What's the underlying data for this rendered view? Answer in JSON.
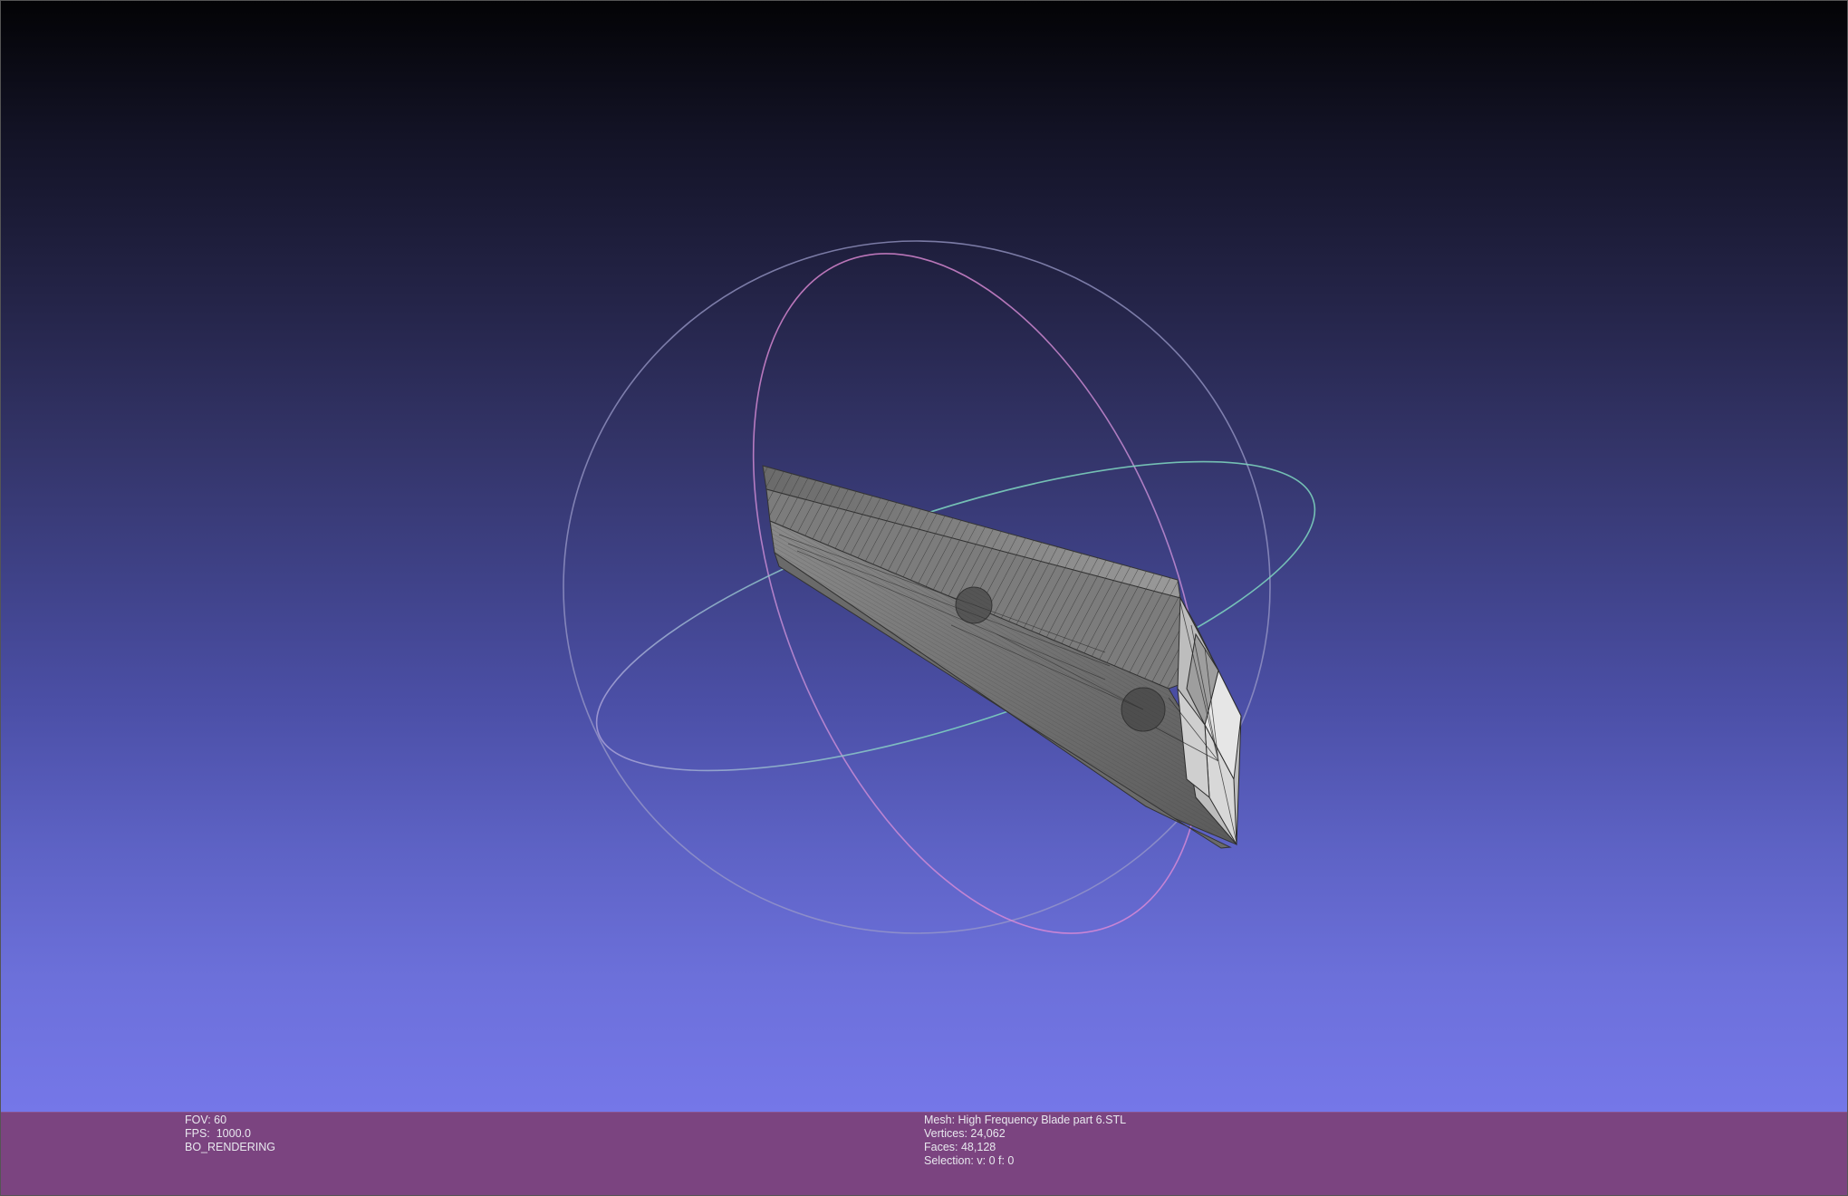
{
  "viewport": {
    "gradient_top": "#030305",
    "gradient_bottom": "#7577e8",
    "mesh_color": "#8c8c8c",
    "mesh_wire_color": "#3a3a3a",
    "trackball_colors": {
      "horizontal_ring": "#7fd7c0",
      "vertical_ring": "#e08ad6",
      "outer_ring": "#9a9ac8"
    }
  },
  "status": {
    "fov_label": "FOV: 60",
    "fps_label": "FPS:  1000.0",
    "render_mode": "BO_RENDERING"
  },
  "mesh_info": {
    "mesh_label": "Mesh: High Frequency Blade part 6.STL",
    "vertices_label": "Vertices: 24,062",
    "faces_label": "Faces: 48,128",
    "selection_label": "Selection: v: 0 f: 0"
  },
  "info_bar": {
    "background": "#7b4480"
  }
}
